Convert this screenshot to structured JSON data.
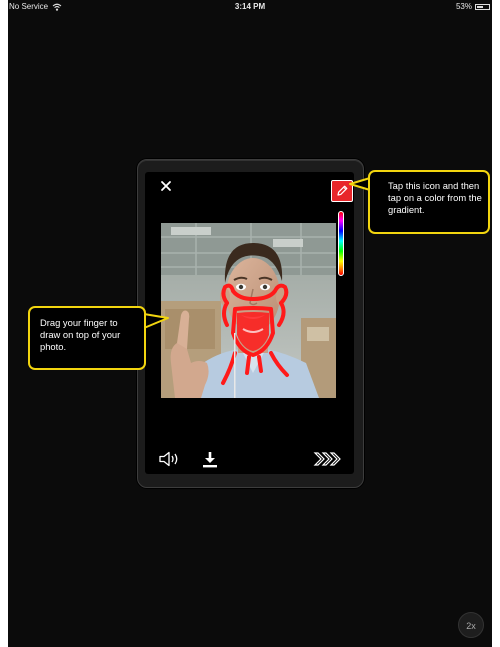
{
  "status_bar": {
    "carrier": "No Service",
    "time": "3:14 PM",
    "battery_percent": "53%",
    "battery_level": 0.53
  },
  "editor": {
    "close_icon": "close-icon",
    "pencil_icon": "pencil-icon",
    "speaker_icon": "speaker-icon",
    "download_icon": "download-icon",
    "next_icon": "forward-chevrons-icon",
    "pencil_color": "#e8262a",
    "drawing_color": "#ff1a1a"
  },
  "callouts": {
    "color_tip": "Tap this icon and then tap on a color from the gradient.",
    "draw_tip": "Drag your finger to draw on top of your photo.",
    "border_color": "#f2d50f"
  },
  "zoom": {
    "label": "2x"
  }
}
